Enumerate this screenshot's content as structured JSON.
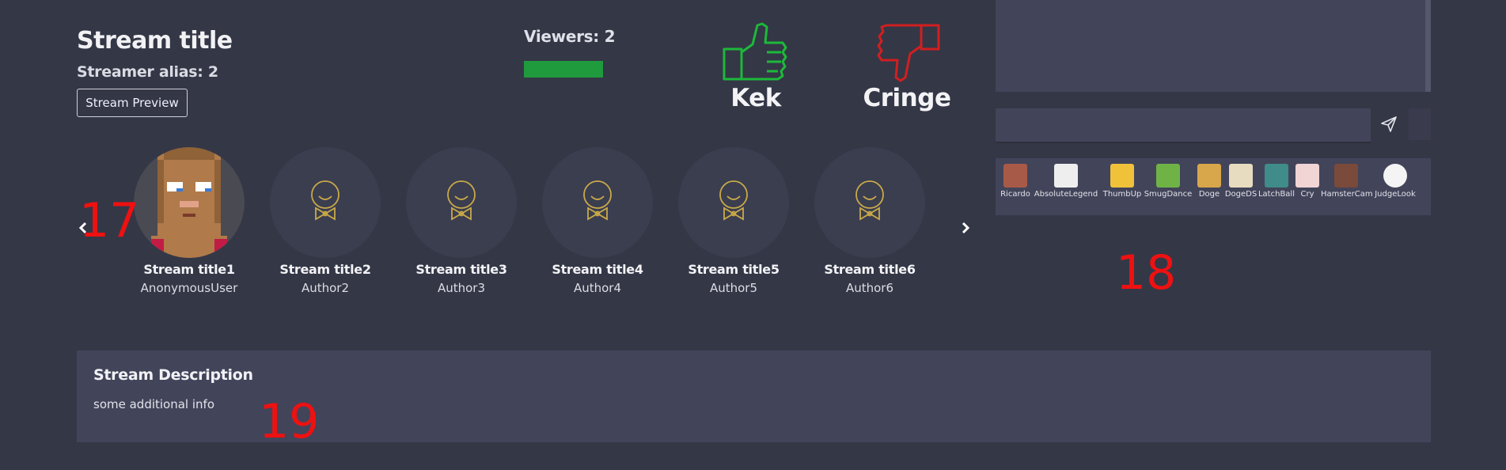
{
  "header": {
    "title": "Stream title",
    "alias_label": "Streamer alias:",
    "alias_value": "2",
    "preview_button": "Stream Preview"
  },
  "viewers": {
    "text": "Viewers: 2",
    "bar_color": "#1f9a3d"
  },
  "votes": {
    "kek": {
      "label": "Kek",
      "color": "#1db83a",
      "icon": "thumbs-up-icon"
    },
    "cringe": {
      "label": "Cringe",
      "color": "#d11f1f",
      "icon": "thumbs-down-icon"
    }
  },
  "chat": {
    "input_value": "",
    "send_icon": "send-icon",
    "emotes": [
      {
        "name": "Ricardo",
        "color": "#a85a48"
      },
      {
        "name": "AbsoluteLegend",
        "color": "#eeeeee"
      },
      {
        "name": "ThumbUp",
        "color": "#f0c23a"
      },
      {
        "name": "SmugDance",
        "color": "#6fb347"
      },
      {
        "name": "Doge",
        "color": "#d8a64b"
      },
      {
        "name": "DogeDS",
        "color": "#e8dcc0"
      },
      {
        "name": "LatchBall",
        "color": "#3f8c8a"
      },
      {
        "name": "Cry",
        "color": "#f1d4d4"
      },
      {
        "name": "HamsterCam",
        "color": "#7a4a3a"
      },
      {
        "name": "JudgeLook",
        "color": "#f4f4f4"
      }
    ]
  },
  "carousel": {
    "prev_icon": "chevron-left-icon",
    "next_icon": "chevron-right-icon",
    "items": [
      {
        "title": "Stream title1",
        "author": "AnonymousUser"
      },
      {
        "title": "Stream title2",
        "author": "Author2"
      },
      {
        "title": "Stream title3",
        "author": "Author3"
      },
      {
        "title": "Stream title4",
        "author": "Author4"
      },
      {
        "title": "Stream title5",
        "author": "Author5"
      },
      {
        "title": "Stream title6",
        "author": "Author6"
      }
    ]
  },
  "description": {
    "title": "Stream Description",
    "text": "some additional info"
  },
  "markers": {
    "m17": "17",
    "m18": "18",
    "m19": "19"
  }
}
